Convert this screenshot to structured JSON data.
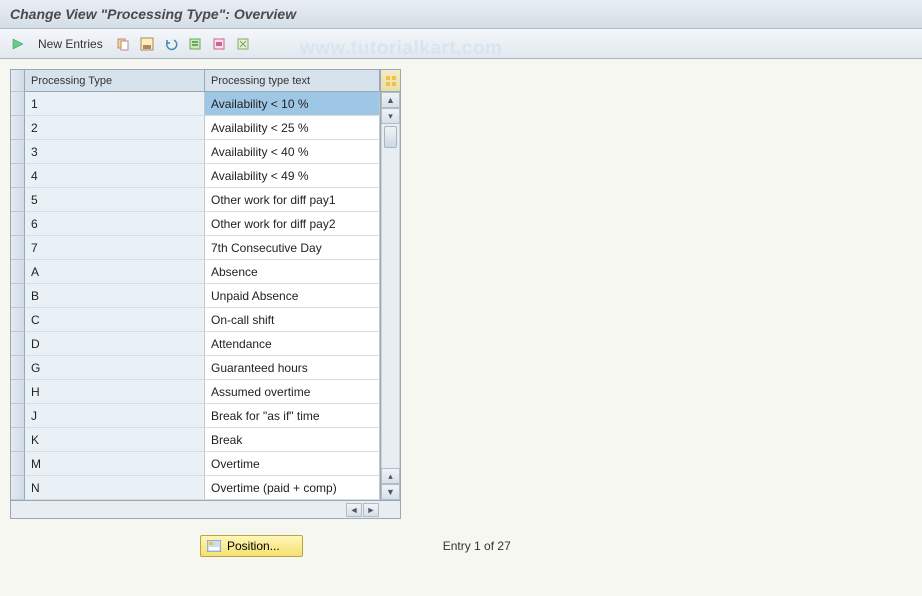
{
  "title": "Change View \"Processing Type\": Overview",
  "watermark": "www.tutorialkart.com",
  "toolbar": {
    "new_entries": "New Entries"
  },
  "table": {
    "col_type": "Processing Type",
    "col_text": "Processing type text",
    "rows": [
      {
        "type": "1",
        "text": "Availability < 10 %",
        "selected": true
      },
      {
        "type": "2",
        "text": "Availability < 25 %"
      },
      {
        "type": "3",
        "text": "Availability < 40 %"
      },
      {
        "type": "4",
        "text": "Availability < 49 %"
      },
      {
        "type": "5",
        "text": "Other work for diff pay1"
      },
      {
        "type": "6",
        "text": "Other work for diff pay2"
      },
      {
        "type": "7",
        "text": "7th Consecutive Day"
      },
      {
        "type": "A",
        "text": "Absence"
      },
      {
        "type": "B",
        "text": "Unpaid Absence"
      },
      {
        "type": "C",
        "text": "On-call shift"
      },
      {
        "type": "D",
        "text": "Attendance"
      },
      {
        "type": "G",
        "text": "Guaranteed hours"
      },
      {
        "type": "H",
        "text": "Assumed overtime"
      },
      {
        "type": "J",
        "text": "Break for \"as if\" time"
      },
      {
        "type": "K",
        "text": "Break"
      },
      {
        "type": "M",
        "text": "Overtime"
      },
      {
        "type": "N",
        "text": "Overtime (paid + comp)"
      }
    ]
  },
  "position_label": "Position...",
  "entry_status": "Entry 1 of 27"
}
